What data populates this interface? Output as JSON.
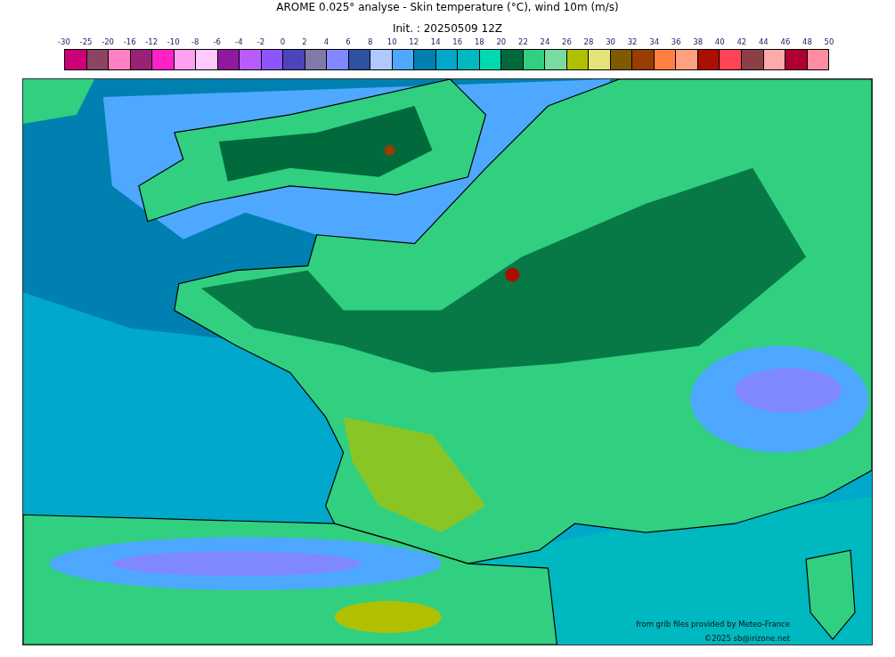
{
  "title": "AROME 0.025° analyse - Skin temperature (°C), wind 10m (m/s)",
  "subtitle": "Init. : 20250509 12Z",
  "colorbar": {
    "ticks": [
      "-30",
      "-25",
      "-20",
      "-16",
      "-12",
      "-10",
      "-8",
      "-6",
      "-4",
      "-2",
      "0",
      "2",
      "4",
      "6",
      "8",
      "10",
      "12",
      "14",
      "16",
      "18",
      "20",
      "22",
      "24",
      "26",
      "28",
      "30",
      "32",
      "34",
      "36",
      "38",
      "40",
      "42",
      "44",
      "46",
      "48",
      "50"
    ],
    "bins": [
      {
        "color": "#cc0077"
      },
      {
        "color": "#8b4560"
      },
      {
        "color": "#ff80c0"
      },
      {
        "color": "#992277"
      },
      {
        "color": "#ff22c8"
      },
      {
        "color": "#ffa0f0"
      },
      {
        "color": "#ffc8ff"
      },
      {
        "color": "#8f1a9f"
      },
      {
        "color": "#b85cff"
      },
      {
        "color": "#8c55ff"
      },
      {
        "color": "#4c44bb"
      },
      {
        "color": "#7f7aa8"
      },
      {
        "color": "#8088ff"
      },
      {
        "color": "#2e52a0"
      },
      {
        "color": "#b0c8ff"
      },
      {
        "color": "#4fa8ff"
      },
      {
        "color": "#0080b0"
      },
      {
        "color": "#00a8cc"
      },
      {
        "color": "#00b8c0"
      },
      {
        "color": "#00d8b0"
      },
      {
        "color": "#006a3c"
      },
      {
        "color": "#30d080"
      },
      {
        "color": "#78dca0"
      },
      {
        "color": "#b0c000"
      },
      {
        "color": "#e6e478"
      },
      {
        "color": "#7f5a00"
      },
      {
        "color": "#993d00"
      },
      {
        "color": "#ff8040"
      },
      {
        "color": "#ffa080"
      },
      {
        "color": "#aa1000"
      },
      {
        "color": "#ff4458"
      },
      {
        "color": "#8b4045"
      },
      {
        "color": "#ffaaaa"
      },
      {
        "color": "#b00033"
      },
      {
        "color": "#ff8ca0"
      }
    ]
  },
  "map": {
    "source_note": "from grib files provided by Meteo-France",
    "copyright": "©2025 sb@irizone.net"
  }
}
